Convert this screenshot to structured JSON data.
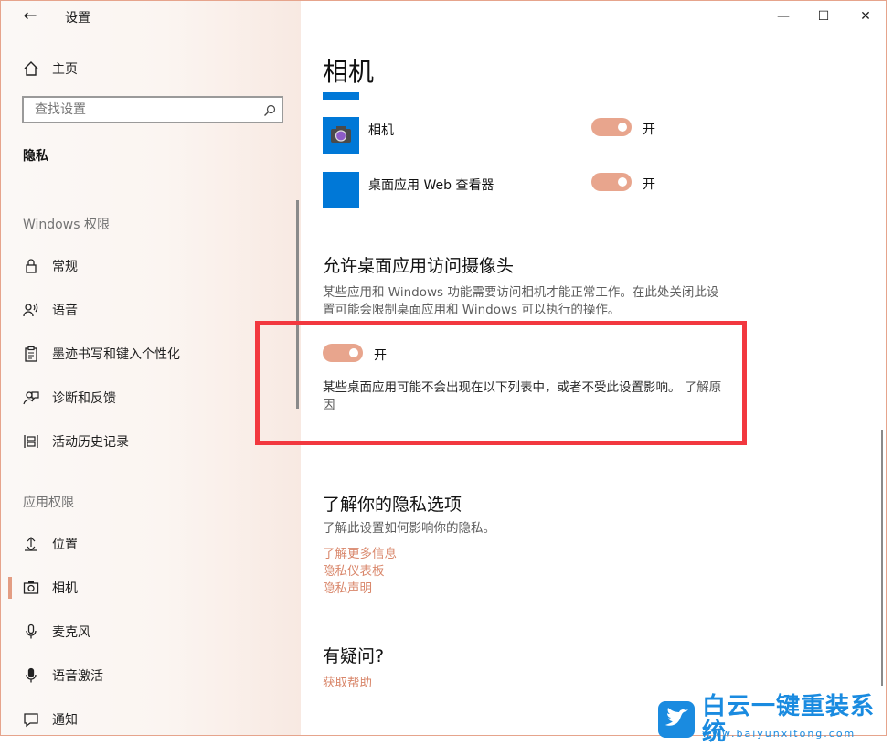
{
  "window": {
    "app_title": "设置",
    "buttons": {
      "back": "←",
      "minimize": "—",
      "maximize": "☐",
      "close": "✕"
    }
  },
  "sidebar": {
    "home": {
      "label": "主页",
      "icon": "home-icon"
    },
    "search": {
      "placeholder": "查找设置",
      "icon": "search-icon"
    },
    "section_title": "隐私",
    "groups": [
      {
        "title": "Windows 权限",
        "items": [
          {
            "label": "常规",
            "icon": "lock-icon"
          },
          {
            "label": "语音",
            "icon": "speech-icon"
          },
          {
            "label": "墨迹书写和键入个性化",
            "icon": "clipboard-icon"
          },
          {
            "label": "诊断和反馈",
            "icon": "feedback-icon"
          },
          {
            "label": "活动历史记录",
            "icon": "timeline-icon"
          }
        ]
      },
      {
        "title": "应用权限",
        "items": [
          {
            "label": "位置",
            "icon": "location-icon"
          },
          {
            "label": "相机",
            "icon": "camera-icon",
            "selected": true
          },
          {
            "label": "麦克风",
            "icon": "microphone-icon"
          },
          {
            "label": "语音激活",
            "icon": "voice-activation-icon"
          },
          {
            "label": "通知",
            "icon": "notification-icon"
          }
        ]
      }
    ]
  },
  "main": {
    "title": "相机",
    "apps": [
      {
        "name": "相机",
        "toggle_state": "开",
        "on": true
      },
      {
        "name": "桌面应用 Web 查看器",
        "toggle_state": "开",
        "on": true
      }
    ],
    "desktop_section": {
      "heading": "允许桌面应用访问摄像头",
      "description_line1": "某些应用和 Windows 功能需要访问相机才能正常工作。在此处关闭此设",
      "description_line2": "置可能会限制桌面应用和 Windows 可以执行的操作。",
      "toggle_state": "开",
      "note_text": "某些桌面应用可能不会出现在以下列表中，或者不受此设置影响。",
      "learn_more": "了解原因"
    },
    "privacy_section": {
      "heading": "了解你的隐私选项",
      "description": "了解此设置如何影响你的隐私。",
      "links": [
        "了解更多信息",
        "隐私仪表板",
        "隐私声明"
      ]
    },
    "question_section": {
      "heading": "有疑问?",
      "link": "获取帮助"
    }
  },
  "watermark": {
    "title": "白云一键重装系统",
    "url": "www.baiyunxitong.com"
  },
  "colors": {
    "accent": "#e8a58d",
    "link": "#d9876b",
    "tile_blue": "#0078d7",
    "highlight_box": "#f2383f",
    "watermark": "#1a8be0"
  }
}
